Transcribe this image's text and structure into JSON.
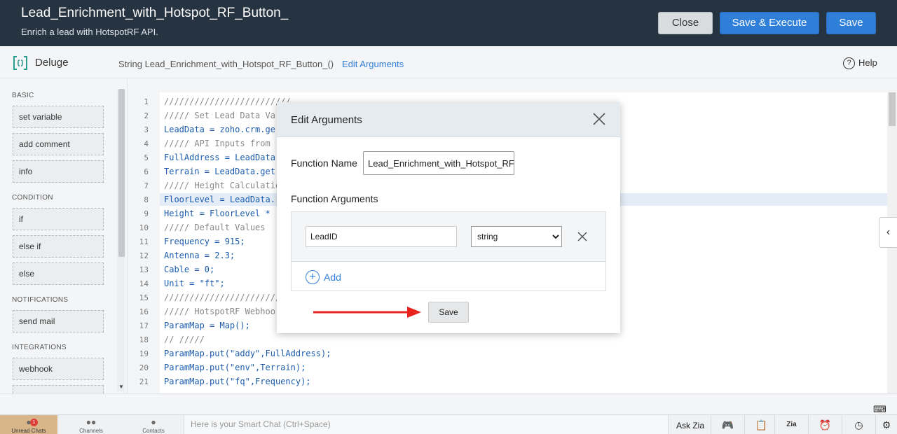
{
  "header": {
    "title": "Lead_Enrichment_with_Hotspot_RF_Button_",
    "subtitle": "Enrich a lead with HotspotRF API.",
    "buttons": {
      "close": "Close",
      "save_execute": "Save & Execute",
      "save": "Save"
    }
  },
  "subbar": {
    "app_label": "Deluge",
    "signature": "String  Lead_Enrichment_with_Hotspot_RF_Button_()",
    "edit_arguments": "Edit Arguments",
    "help": "Help"
  },
  "leftpanel": {
    "sections": [
      {
        "heading": "BASIC",
        "items": [
          "set variable",
          "add comment",
          "info"
        ]
      },
      {
        "heading": "CONDITION",
        "items": [
          "if",
          "else if",
          "else"
        ]
      },
      {
        "heading": "NOTIFICATIONS",
        "items": [
          "send mail"
        ]
      },
      {
        "heading": "INTEGRATIONS",
        "items": [
          "webhook"
        ]
      }
    ]
  },
  "editor": {
    "line_numbers": [
      "1",
      "2",
      "3",
      "4",
      "5",
      "6",
      "7",
      "8",
      "9",
      "10",
      "11",
      "12",
      "13",
      "14",
      "15",
      "16",
      "17",
      "18",
      "19",
      "20",
      "21"
    ],
    "lines": [
      "/////////////////////////",
      "///// Set Lead Data Va",
      "LeadData = zoho.crm.ge",
      "///// API Inputs from",
      "FullAddress = LeadData",
      "Terrain = LeadData.get",
      "///// Height Calculatio",
      "FloorLevel = LeadData.",
      "Height = FloorLevel * ",
      "///// Default Values",
      "Frequency = 915;",
      "Antenna = 2.3;",
      "Cable = 0;",
      "Unit = \"ft\";",
      "///////////////////////",
      "///// HotspotRF Webhoo",
      "ParamMap = Map();",
      "// /////",
      "ParamMap.put(\"addy\",FullAddress);",
      "ParamMap.put(\"env\",Terrain);",
      "ParamMap.put(\"fq\",Frequency);"
    ]
  },
  "modal": {
    "title": "Edit Arguments",
    "function_name_label": "Function Name",
    "function_name_value": "Lead_Enrichment_with_Hotspot_RF",
    "function_arguments_label": "Function Arguments",
    "argument": {
      "name": "LeadID",
      "type": "string"
    },
    "type_options": [
      "string"
    ],
    "add_label": "Add",
    "save_label": "Save"
  },
  "bottombar": {
    "unread_chats": "Unread Chats",
    "unread_count": "1",
    "channels": "Channels",
    "contacts": "Contacts",
    "smartchat_placeholder": "Here is your Smart Chat (Ctrl+Space)",
    "ask_zia": "Ask Zia"
  },
  "colors": {
    "header_bg": "#263340",
    "primary": "#2f7ed8",
    "arrow": "#e8231c"
  }
}
